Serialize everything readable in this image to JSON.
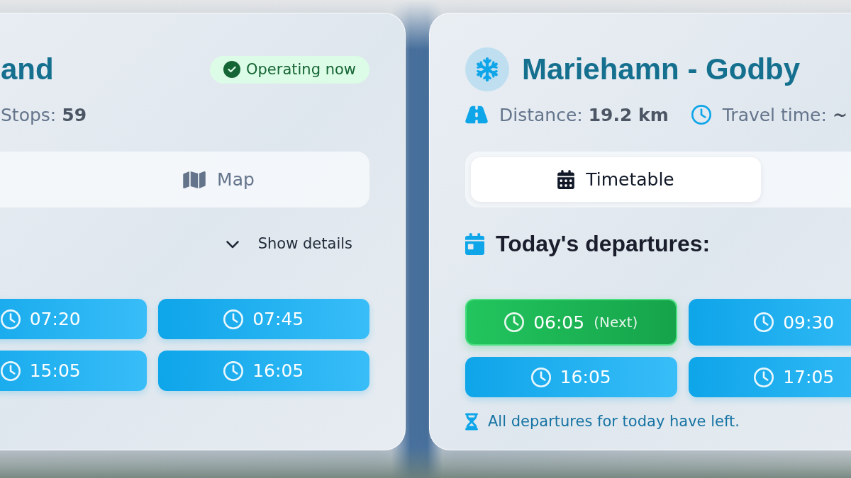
{
  "cards": [
    {
      "title": "and",
      "status": {
        "label": "Operating now",
        "active": true
      },
      "stats": [
        {
          "kind": "stops",
          "text": "Stops: **59**"
        }
      ],
      "tabs": [
        {
          "kind": "map",
          "label": "Map",
          "selected": false
        }
      ],
      "details_toggle": {
        "label": "Show details",
        "expanded": false
      },
      "departures": [
        {
          "time": "07:20",
          "next": false
        },
        {
          "time": "07:45",
          "next": false
        },
        {
          "time": "15:05",
          "next": false
        },
        {
          "time": "16:05",
          "next": false
        }
      ]
    },
    {
      "title": "Mariehamn - Godby",
      "icon_badge": true,
      "stats": [
        {
          "kind": "distance",
          "text": "Distance: **19.2 km**"
        },
        {
          "kind": "duration",
          "text": "Travel time: **~**"
        }
      ],
      "tabs": [
        {
          "kind": "timetable",
          "label": "Timetable",
          "selected": true
        }
      ],
      "heading": "Today's departures:",
      "departures": [
        {
          "time": "06:05",
          "next": true,
          "note": "(Next)"
        },
        {
          "time": "09:30",
          "next": false
        },
        {
          "time": "16:05",
          "next": false
        },
        {
          "time": "17:05",
          "next": false
        }
      ],
      "notice": "All departures for today have left."
    }
  ]
}
